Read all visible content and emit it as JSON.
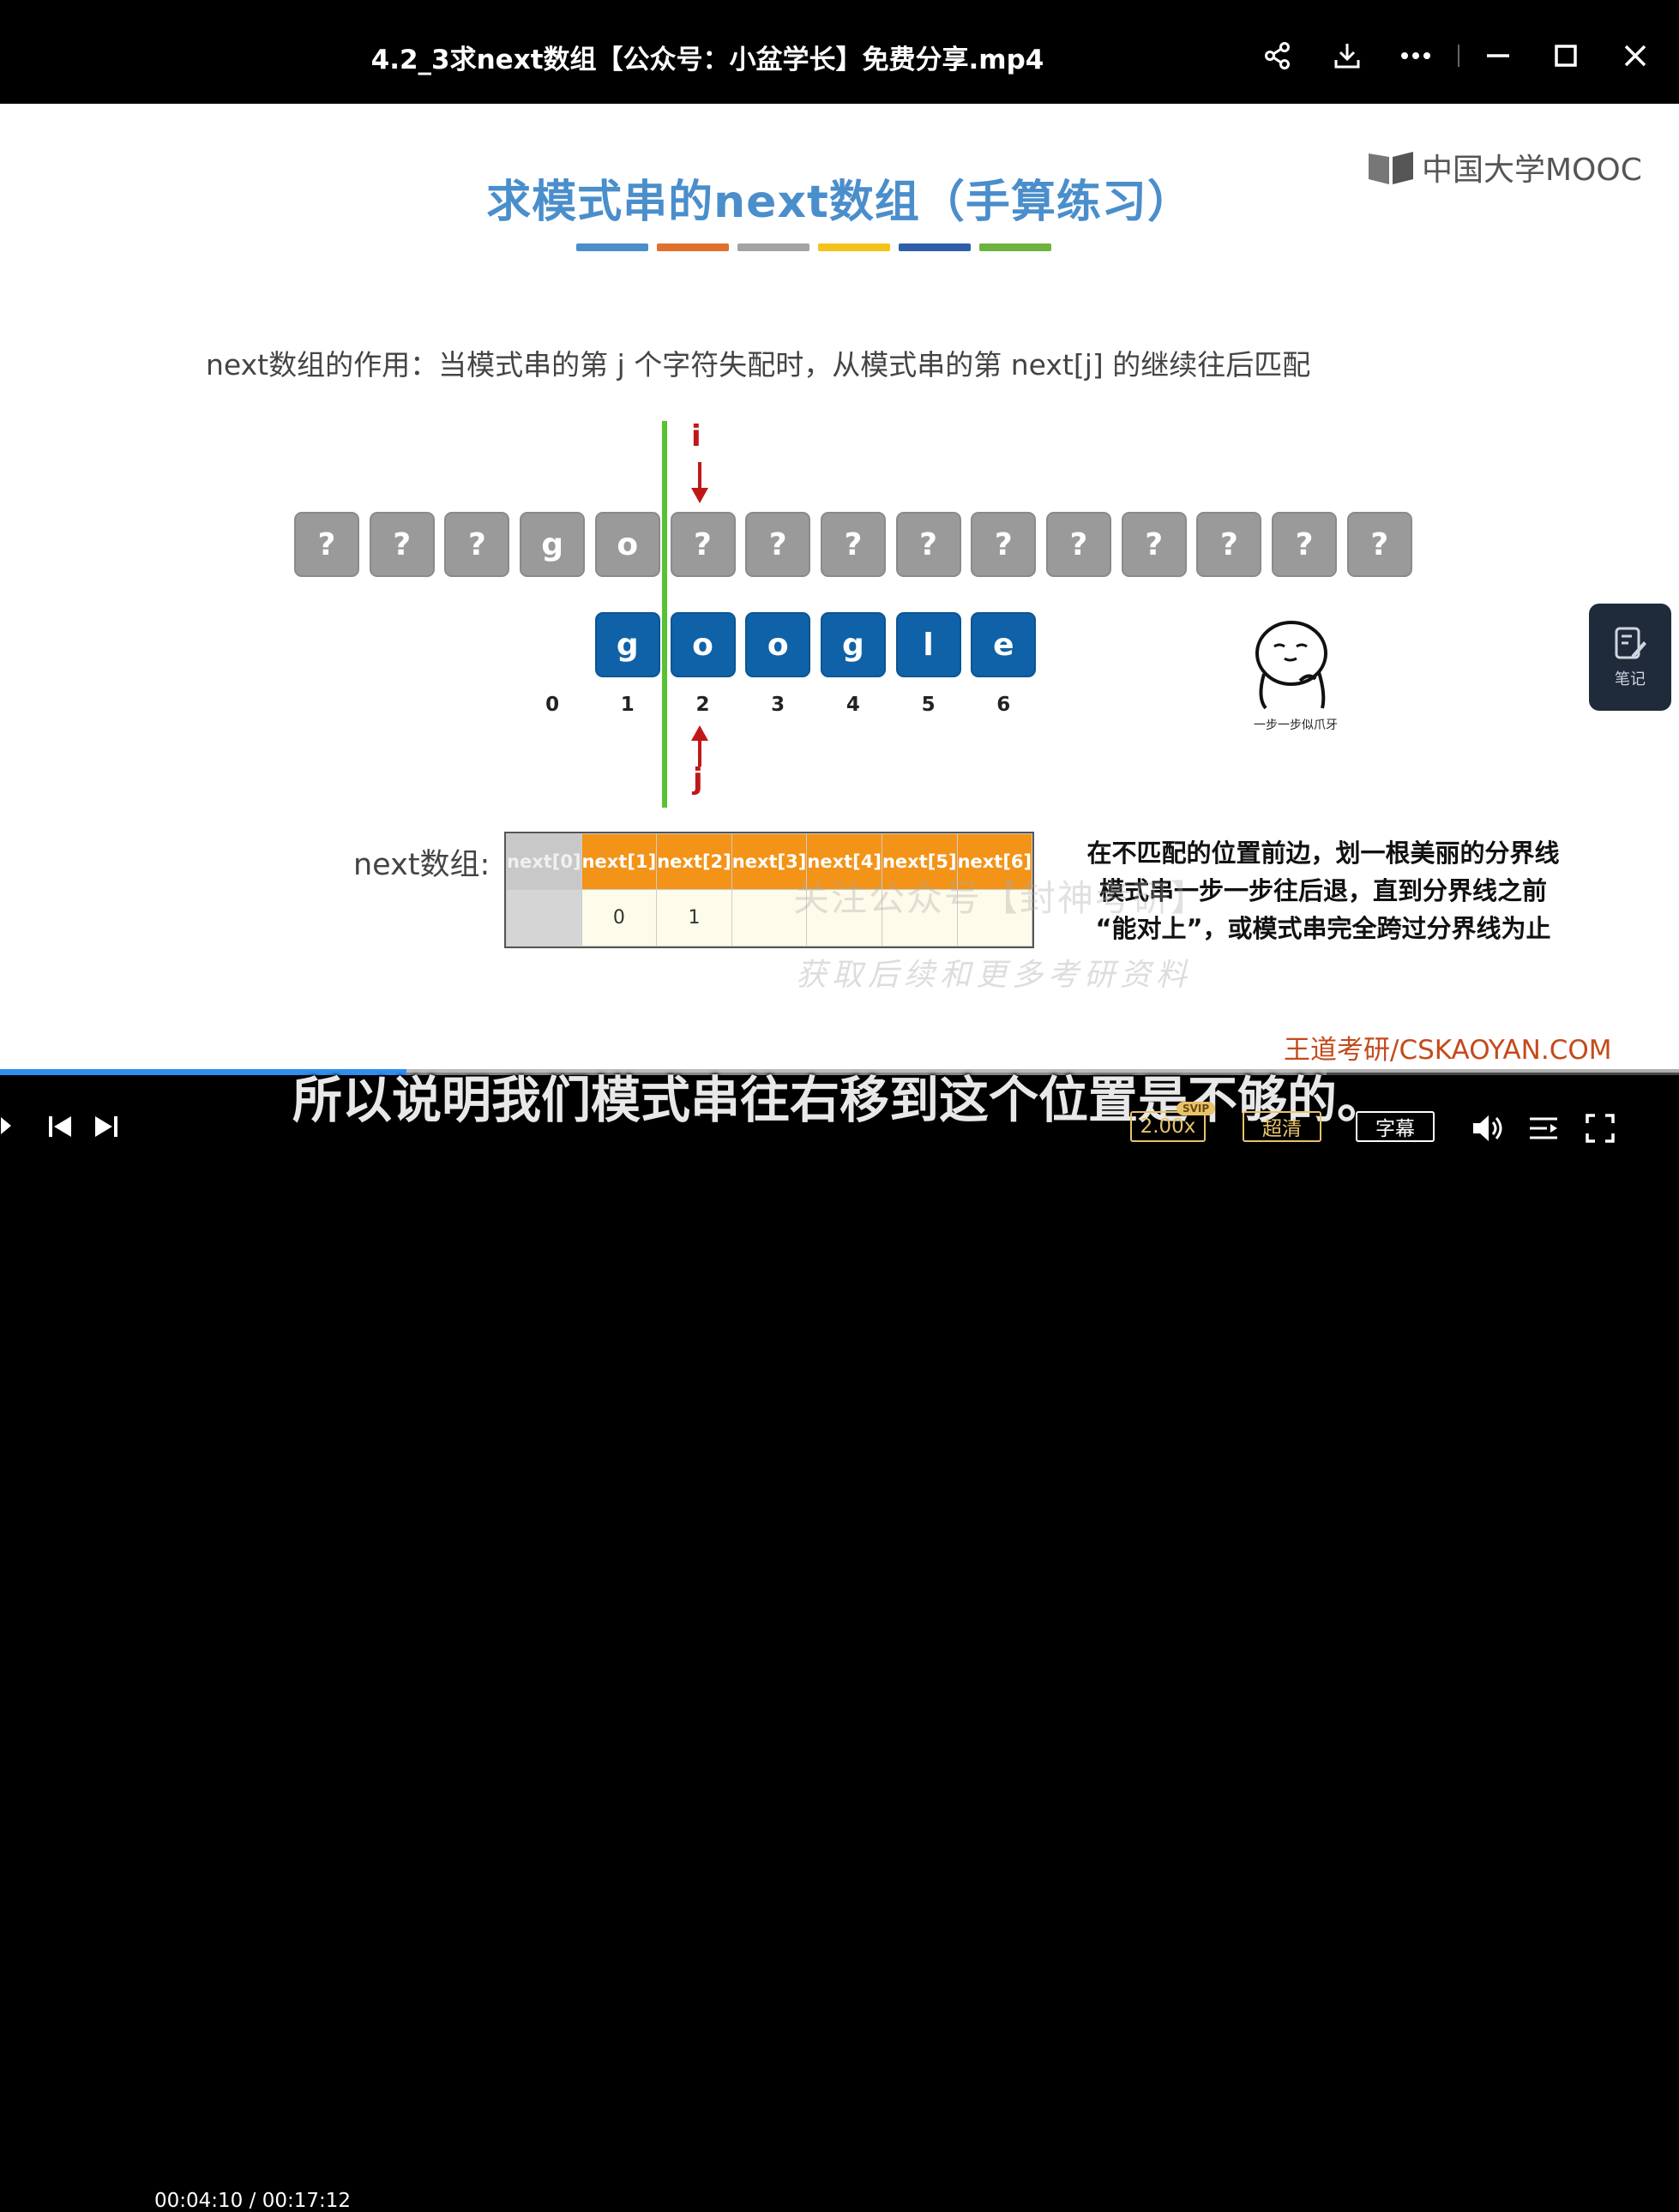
{
  "window": {
    "title": "4.2_3求next数组【公众号：小盆学长】免费分享.mp4",
    "icons": [
      "share-icon",
      "download-icon",
      "more-icon",
      "minimize-icon",
      "maximize-icon",
      "close-icon"
    ]
  },
  "slide": {
    "heading": "求模式串的next数组（手算练习）",
    "heading_bar_colors": [
      "#4a8ecb",
      "#e0702c",
      "#a3a3a3",
      "#f5c21a",
      "#2f5ea8",
      "#6cb33f"
    ],
    "logo_text": "中国大学MOOC",
    "description": "next数组的作用：当模式串的第 j 个字符失配时，从模式串的第 next[j] 的继续往后匹配",
    "main_string": [
      "?",
      "?",
      "?",
      "g",
      "o",
      "?",
      "?",
      "?",
      "?",
      "?",
      "?",
      "?",
      "?",
      "?",
      "?"
    ],
    "pattern": [
      "g",
      "o",
      "o",
      "g",
      "l",
      "e"
    ],
    "indices": [
      "0",
      "1",
      "2",
      "3",
      "4",
      "5",
      "6"
    ],
    "pointer_i": "i",
    "pointer_j": "j",
    "next_label": "next数组:",
    "next_headers": [
      "next[0]",
      "next[1]",
      "next[2]",
      "next[3]",
      "next[4]",
      "next[5]",
      "next[6]"
    ],
    "next_values": [
      "",
      "0",
      "1",
      "",
      "",
      "",
      ""
    ],
    "note_lines": [
      "在不匹配的位置前边，划一根美丽的分界线",
      "模式串一步一步往后退，直到分界线之前",
      "“能对上”，或模式串完全跨过分界线为止"
    ],
    "watermark_line1": "关注公众号【封神考研】",
    "watermark_line2": "获取后续和更多考研资料",
    "emoji_caption": "一步一步似爪牙",
    "footer_brand": "王道考研/CSKAOYAN.COM",
    "note_button_label": "笔记"
  },
  "player": {
    "subtitle": "所以说明我们模式串往右移到这个位置是不够的。",
    "current_time": "00:04:10",
    "total_time": "00:17:12",
    "progress_fraction": 0.242,
    "buffer_fraction": 0.79,
    "speed": "2.00x",
    "speed_badge": "SVIP",
    "quality": "超清",
    "captions": "字幕",
    "accent_color": "#2f8ff0"
  }
}
